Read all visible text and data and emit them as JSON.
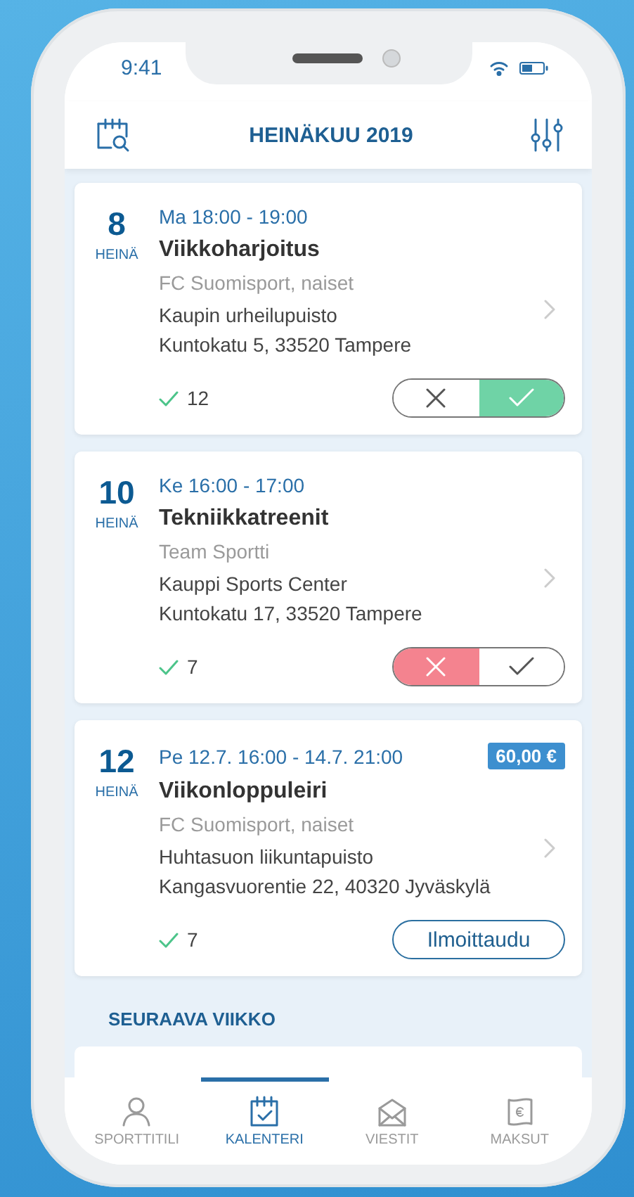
{
  "status_bar": {
    "time": "9:41"
  },
  "header": {
    "title": "HEINÄKUU 2019"
  },
  "events": [
    {
      "day": "8",
      "month": "HEINÄ",
      "time": "Ma 18:00 - 19:00",
      "title": "Viikkoharjoitus",
      "team": "FC Suomisport, naiset",
      "venue": "Kaupin urheilupuisto",
      "address": "Kuntokatu 5, 33520 Tampere",
      "attendees": "12",
      "kind": "rsvp",
      "attending": true
    },
    {
      "day": "10",
      "month": "HEINÄ",
      "time": "Ke 16:00 - 17:00",
      "title": "Tekniikkatreenit",
      "team": "Team Sportti",
      "venue": "Kauppi Sports Center",
      "address": "Kuntokatu 17, 33520 Tampere",
      "attendees": "7",
      "kind": "rsvp",
      "attending": false
    },
    {
      "day": "12",
      "month": "HEINÄ",
      "time": "Pe 12.7. 16:00 - 14.7. 21:00",
      "price": "60,00 €",
      "title": "Viikonloppuleiri",
      "team": "FC Suomisport, naiset",
      "venue": "Huhtasuon liikuntapuisto",
      "address": "Kangasvuorentie 22, 40320 Jyväskylä",
      "attendees": "7",
      "kind": "signup",
      "button": "Ilmoittaudu"
    }
  ],
  "section": {
    "title": "SEURAAVA VIIKKO"
  },
  "tabs": [
    {
      "label": "SPORTTITILI",
      "kind": "account",
      "selected": false
    },
    {
      "label": "KALENTERI",
      "kind": "calendar",
      "selected": true
    },
    {
      "label": "VIESTIT",
      "kind": "messages",
      "selected": false
    },
    {
      "label": "MAKSUT",
      "kind": "payments",
      "selected": false
    }
  ]
}
